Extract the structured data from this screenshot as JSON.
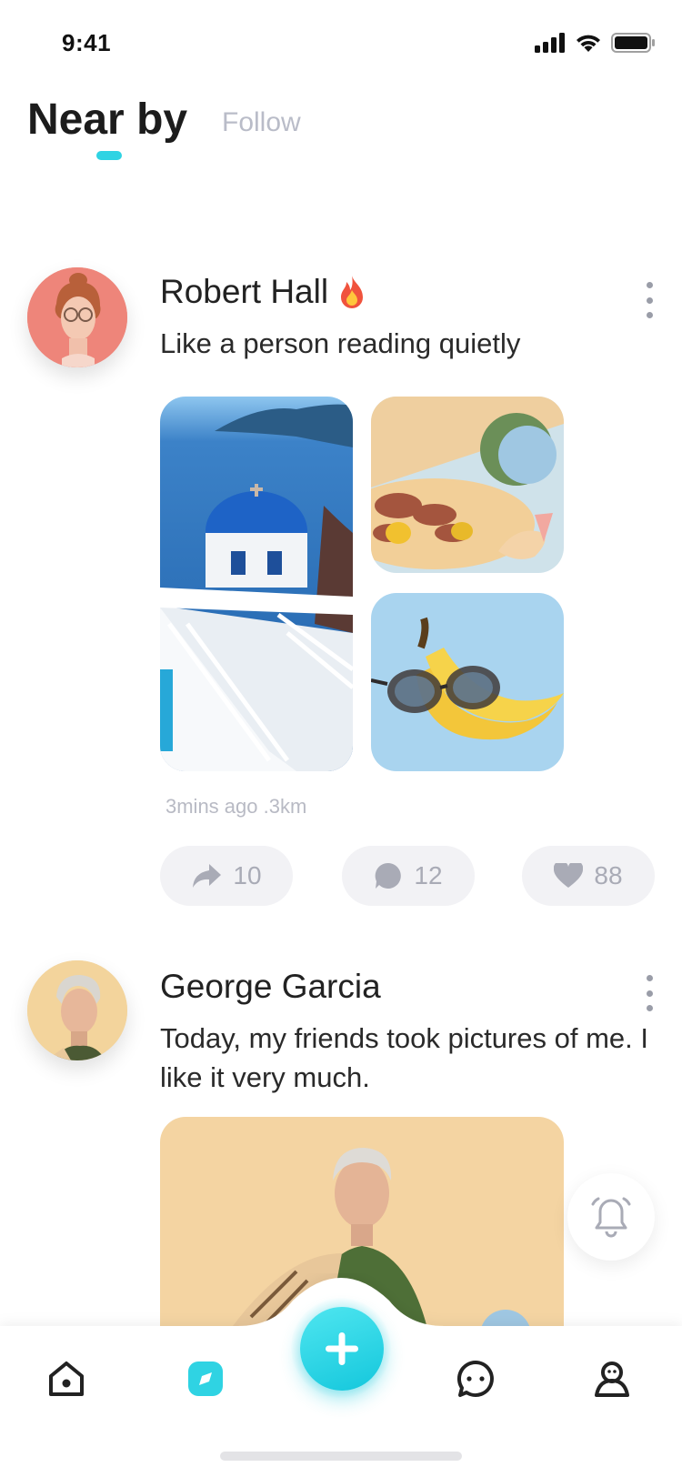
{
  "status_bar": {
    "time": "9:41"
  },
  "header": {
    "tab_active": "Near by",
    "tab_inactive": "Follow"
  },
  "posts": [
    {
      "username": "Robert Hall",
      "text": "Like a person reading quietly",
      "meta": "3mins ago .3km",
      "shares": "10",
      "comments": "12",
      "likes": "88"
    },
    {
      "username": "George Garcia",
      "text": "Today, my friends took pictures of me. I like it very much."
    }
  ],
  "colors": {
    "accent": "#2fd3e3",
    "text_primary": "#222222",
    "text_muted": "#b9bcc8",
    "action_bg": "#f2f2f5"
  },
  "icons": [
    "signal-icon",
    "wifi-icon",
    "battery-icon",
    "fire-icon",
    "more-icon",
    "share-icon",
    "comment-icon",
    "heart-icon",
    "bell-icon",
    "home-icon",
    "discover-icon",
    "plus-icon",
    "chat-icon",
    "profile-icon"
  ]
}
